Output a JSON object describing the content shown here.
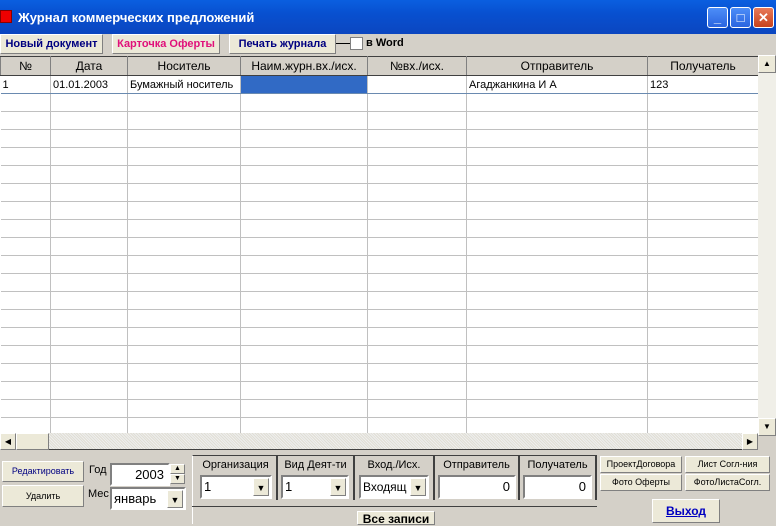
{
  "window": {
    "title": "Журнал коммерческих предложений",
    "minimize": "_",
    "maximize": "□",
    "close": "✕"
  },
  "toolbar": {
    "new_doc": "Новый документ",
    "offer_card": "Карточка Оферты",
    "print_journal": "Печать журнала",
    "in_word": "в Word",
    "in_word_checked": false,
    "offer_card_color": "#e0107a",
    "button_text_color": "#000080"
  },
  "grid": {
    "columns": [
      "№",
      "Дата",
      "Носитель",
      "Наим.журн.вх./исх.",
      "№вх./исх.",
      "Отправитель",
      "Получатель"
    ],
    "rows": [
      [
        "1",
        "01.01.2003",
        "Бумажный носитель",
        "",
        "",
        "Агаджанкина И А",
        "123"
      ]
    ],
    "selection_color": "#316ac5"
  },
  "bottom": {
    "edit": "Редактировать",
    "delete": "Удалить",
    "year_label": "Год",
    "year": "2003",
    "month_label": "Мес",
    "month": "январь",
    "filters": {
      "org_label": "Организация",
      "org": "1",
      "activity_label": "Вид Деят-ти",
      "activity": "1",
      "direction_label": "Вход./Исх.",
      "direction": "Входящ",
      "sender_label": "Отправитель",
      "sender": "0",
      "recipient_label": "Получатель",
      "recipient": "0"
    },
    "all_records": "Все записи",
    "contract_draft": "ПроектДоговора",
    "approval_sheet": "Лист Согл-ния",
    "offer_photo": "Фото Оферты",
    "approval_photo": "ФотоЛистаСогл.",
    "exit": "Выход"
  }
}
